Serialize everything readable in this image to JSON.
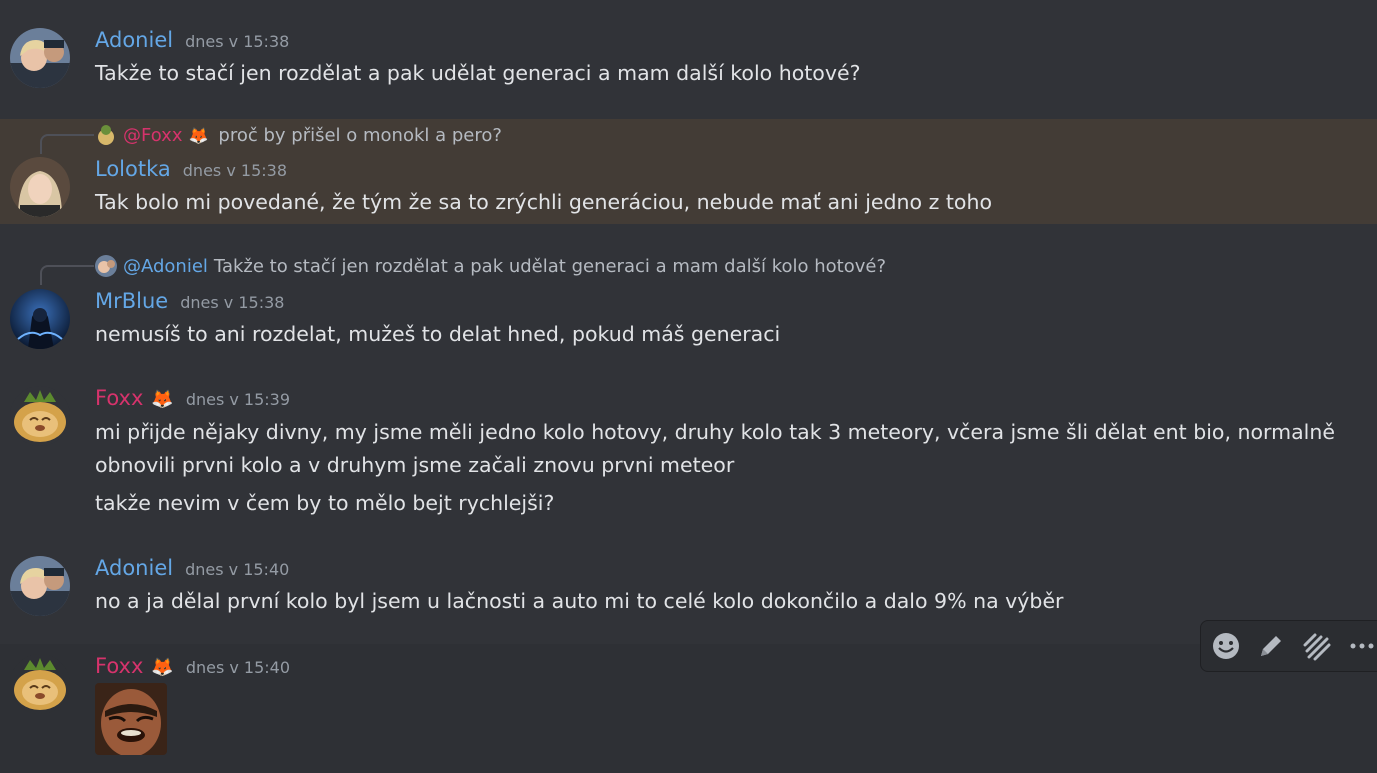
{
  "messages": [
    {
      "author": "Adoniel",
      "time": "dnes v 15:38",
      "lines": [
        "Takže to stačí jen rozdělat a pak udělat generaci a mam další kolo hotové?"
      ]
    },
    {
      "author": "Lolotka",
      "time": "dnes v 15:38",
      "reply": {
        "mention": "@Foxx",
        "badge": "🦊",
        "text": "proč by přišel o monokl a pero?"
      },
      "lines": [
        "Tak bolo mi povedané, že tým že sa to zrýchli generáciou, nebude mať ani jedno z toho"
      ]
    },
    {
      "author": "MrBlue",
      "time": "dnes v 15:38",
      "reply": {
        "mention": "@Adoniel",
        "text": "Takže to stačí jen rozdělat a pak udělat generaci a mam další kolo hotové?"
      },
      "lines": [
        "nemusíš to ani rozdelat, mužeš to delat hned, pokud máš generaci"
      ]
    },
    {
      "author": "Foxx",
      "badge": "🦊",
      "time": "dnes v 15:39",
      "lines": [
        "mi přijde nějaky divny, my jsme měli jedno kolo hotovy, druhy kolo tak 3 meteory, včera jsme šli dělat ent bio, normalně",
        "obnovili prvni kolo a v druhym jsme začali znovu prvni meteor",
        "takže nevim v čem by to mělo bejt rychlejši?"
      ]
    },
    {
      "author": "Adoniel",
      "time": "dnes v 15:40",
      "lines": [
        "no a ja dělal první kolo byl jsem u lačnosti a auto mi to celé kolo dokončilo a dalo 9% na výběr"
      ]
    },
    {
      "author": "Foxx",
      "badge": "🦊",
      "time": "dnes v 15:40",
      "lines": []
    }
  ],
  "toolbar": {
    "icons": [
      "add-reaction-icon",
      "edit-icon",
      "reply-thread-icon",
      "more-icon"
    ]
  },
  "colors": {
    "background": "#313338",
    "highlight": "#433c36",
    "blue_user": "#64a7e6",
    "pink_user": "#d6336c"
  }
}
